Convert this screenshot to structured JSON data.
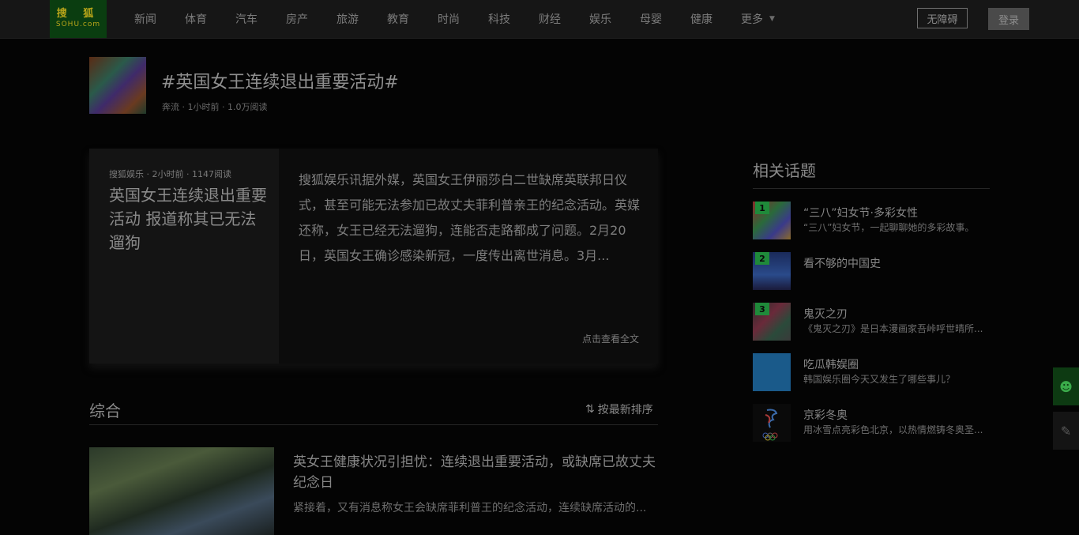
{
  "header": {
    "logo": {
      "line1": "搜 狐",
      "line2": "SOHU.com"
    },
    "nav_items": [
      "新闻",
      "体育",
      "汽车",
      "房产",
      "旅游",
      "教育",
      "时尚",
      "科技",
      "财经",
      "娱乐",
      "母婴",
      "健康"
    ],
    "more_label": "更多",
    "newsroom_label": "无障碍",
    "login_label": "登录"
  },
  "topic": {
    "title": "#英国女王连续退出重要活动#",
    "meta": "奔流 · 1小时前 · 1.0万阅读"
  },
  "feature": {
    "meta": "搜狐娱乐 · 2小时前 · 1147阅读",
    "title": "英国女王连续退出重要活动 报道称其已无法遛狗",
    "body": "搜狐娱乐讯据外媒，英国女王伊丽莎白二世缺席英联邦日仪式，甚至可能无法参加已故丈夫菲利普亲王的纪念活动。英媒还称，女王已经无法遛狗，连能否走路都成了问题。2月20日，英国女王确诊感染新冠，一度传出离世消息。3月...",
    "read_more": "点击查看全文"
  },
  "section": {
    "title": "综合",
    "sort_label": "按最新排序"
  },
  "article": {
    "title": "英女王健康状况引担忧：连续退出重要活动，或缺席已故丈夫纪念日",
    "summary": "紧接着，又有消息称女王会缺席菲利普王的纪念活动，连续缺席活动的..."
  },
  "related": {
    "title": "相关话题",
    "items": [
      {
        "rank": "1",
        "name": "“三八”妇女节·多彩女性",
        "desc": "“三八”妇女节，一起聊聊她的多彩故事。"
      },
      {
        "rank": "2",
        "name": "看不够的中国史",
        "desc": ""
      },
      {
        "rank": "3",
        "name": "鬼灭之刃",
        "desc": "《鬼灭之刃》是日本漫画家吾峠呼世晴所..."
      },
      {
        "rank": "",
        "name": "吃瓜韩娱圈",
        "desc": "韩国娱乐圈今天又发生了哪些事儿？"
      },
      {
        "rank": "",
        "name": "京彩冬奥",
        "desc": "用冰雪点亮彩色北京，以热情燃铸冬奥圣..."
      }
    ]
  },
  "colors": {
    "background": "#040404",
    "rank_badge": "#1f8a3a",
    "logo_bg": "#0a3d10",
    "float_green": "#0d3a12"
  },
  "icons": {
    "more": "chevron-down-icon",
    "sort": "sort-arrows-icon",
    "float_1": "user-icon",
    "float_2": "edit-icon"
  }
}
